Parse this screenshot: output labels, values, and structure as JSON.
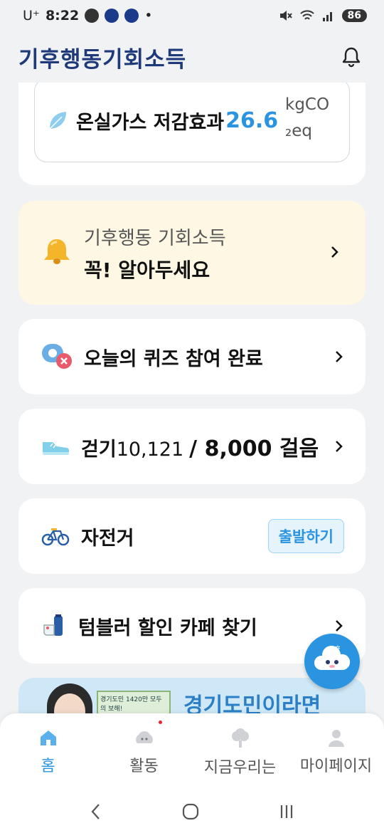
{
  "status_bar": {
    "carrier": "U⁺",
    "time": "8:22",
    "dot": "•",
    "battery": "86"
  },
  "header": {
    "logo": "기후행동기회소득"
  },
  "carbon": {
    "label": "온실가스 저감효과",
    "value": "26.6",
    "unit_top": "kgCO",
    "unit_bottom": "₂eq"
  },
  "notice": {
    "subtitle": "기후행동 기회소득",
    "title": "꼭! 알아두세요"
  },
  "quiz": {
    "label": "오늘의 퀴즈 참여 완료"
  },
  "walk": {
    "label": "걷기",
    "current": "10,121",
    "goal": "/ 8,000 걸음"
  },
  "bike": {
    "label": "자전거",
    "button": "출발하기"
  },
  "tumbler": {
    "label": "텀블러 할인 카페 찾기"
  },
  "banner": {
    "headline": "경기도민이라면",
    "poster_text": "경기도민 1420만 모두의 보해!"
  },
  "bottom_nav": [
    {
      "label": "홈",
      "icon": "home-icon",
      "active": true
    },
    {
      "label": "활동",
      "icon": "activity-icon",
      "active": false
    },
    {
      "label": "지금우리는",
      "icon": "tree-icon",
      "active": false
    },
    {
      "label": "마이페이지",
      "icon": "person-icon",
      "active": false
    }
  ],
  "system_nav": {
    "back": "<",
    "home": "○",
    "recents": "|||"
  },
  "colors": {
    "accent": "#2b94e0",
    "brand": "#1f3a7a",
    "notice_bg": "#fdf7e3",
    "page_bg": "#f1f2f4"
  }
}
